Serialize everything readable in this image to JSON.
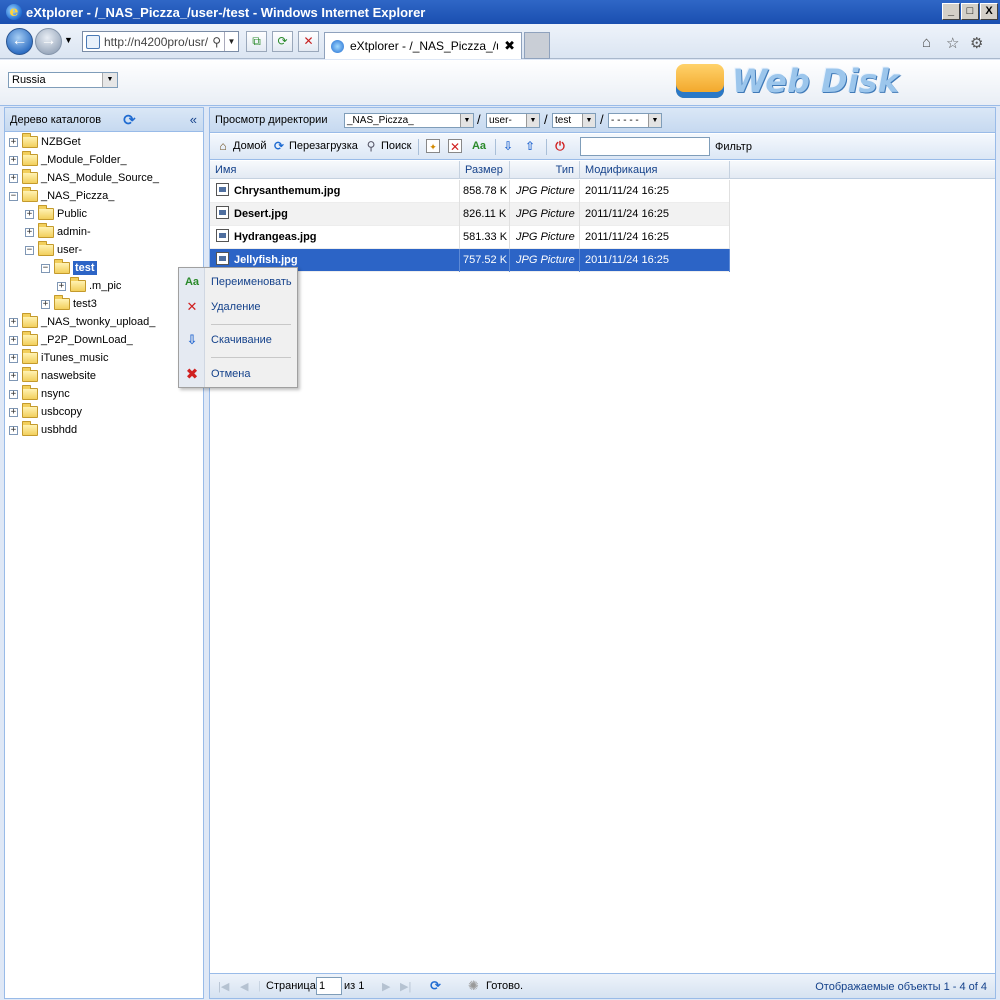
{
  "window": {
    "title": "eXtplorer - /_NAS_Piczza_/user-/test - Windows Internet Explorer",
    "minimize": "_",
    "maximize": "□",
    "close": "X"
  },
  "browser": {
    "address": "http://n4200pro/usr/",
    "tab_title": "eXtplorer - /_NAS_Piczza_/u...",
    "tab_close": "✖"
  },
  "header": {
    "language": "Russia",
    "logo_text": "Web Disk"
  },
  "tree": {
    "title": "Дерево каталогов",
    "nodes": [
      {
        "label": "NZBGet",
        "expander": "+"
      },
      {
        "label": "_Module_Folder_",
        "expander": "+"
      },
      {
        "label": "_NAS_Module_Source_",
        "expander": "+"
      },
      {
        "label": "_NAS_Piczza_",
        "expander": "−"
      },
      {
        "label": "Public",
        "expander": "+"
      },
      {
        "label": "admin-",
        "expander": "+"
      },
      {
        "label": "user-",
        "expander": "−"
      },
      {
        "label": "test",
        "expander": "−"
      },
      {
        "label": ".m_pic",
        "expander": "+"
      },
      {
        "label": "test3",
        "expander": "+"
      },
      {
        "label": "_NAS_twonky_upload_",
        "expander": "+"
      },
      {
        "label": "_P2P_DownLoad_",
        "expander": "+"
      },
      {
        "label": "iTunes_music",
        "expander": "+"
      },
      {
        "label": "naswebsite",
        "expander": "+"
      },
      {
        "label": "nsync",
        "expander": "+"
      },
      {
        "label": "usbcopy",
        "expander": "+"
      },
      {
        "label": "usbhdd",
        "expander": "+"
      }
    ]
  },
  "dirbar": {
    "label": "Просмотр директории",
    "combo1": "_NAS_Piczza_",
    "combo2": "user-",
    "combo3": "test",
    "combo4": "- - - - -",
    "slash": "/"
  },
  "toolbar": {
    "home": "Домой",
    "reload": "Перезагрузка",
    "search": "Поиск",
    "filter": "Фильтр",
    "filter_value": ""
  },
  "grid": {
    "columns": {
      "name": "Имя",
      "size": "Размер",
      "type": "Тип",
      "modified": "Модификация"
    },
    "rows": [
      {
        "name": "Chrysanthemum.jpg",
        "size": "858.78 K",
        "type": "JPG Picture",
        "modified": "2011/11/24 16:25"
      },
      {
        "name": "Desert.jpg",
        "size": "826.11 K",
        "type": "JPG Picture",
        "modified": "2011/11/24 16:25"
      },
      {
        "name": "Hydrangeas.jpg",
        "size": "581.33 K",
        "type": "JPG Picture",
        "modified": "2011/11/24 16:25"
      },
      {
        "name": "Jellyfish.jpg",
        "size": "757.52 K",
        "type": "JPG Picture",
        "modified": "2011/11/24 16:25"
      }
    ]
  },
  "context_menu": {
    "rename": "Переименовать",
    "delete": "Удаление",
    "download": "Скачивание",
    "cancel": "Отмена"
  },
  "status": {
    "page_label": "Страница",
    "page_value": "1",
    "of_label": "из 1",
    "ready": "Готово.",
    "displayed": "Отображаемые объекты 1 - 4 of 4"
  },
  "colors": {
    "selection": "#2c64c6",
    "panel_border": "#99bbe8",
    "header_text": "#15428b"
  }
}
